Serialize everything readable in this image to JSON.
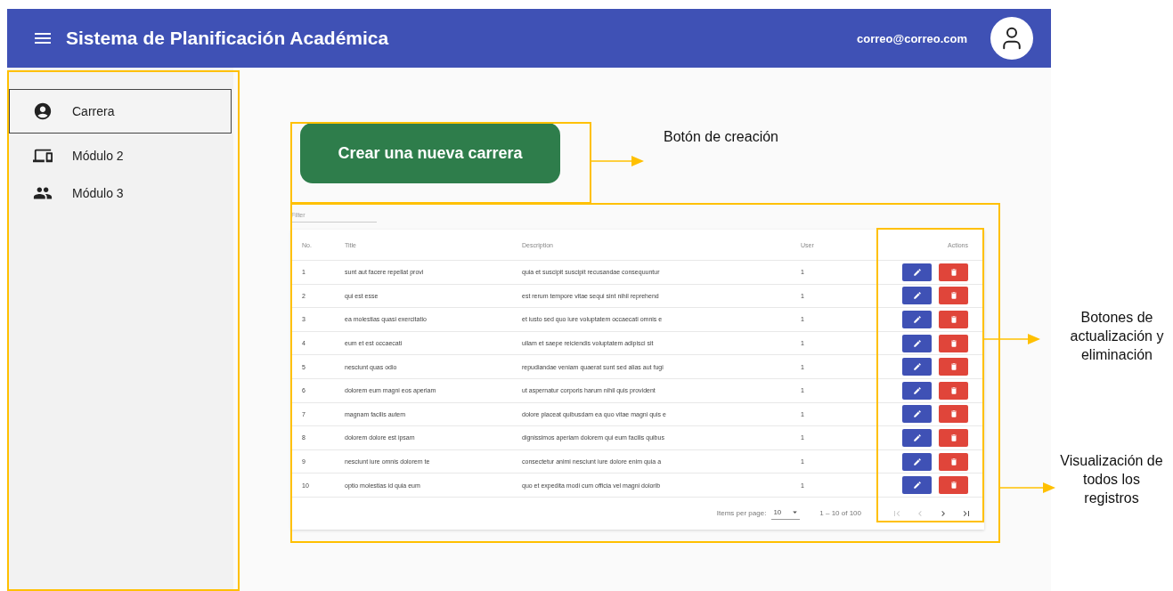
{
  "app_bar": {
    "title": "Sistema de Planificación Académica",
    "email": "correo@correo.com"
  },
  "sidebar": {
    "items": [
      {
        "kind": "account",
        "label": "Carrera",
        "selected": true
      },
      {
        "kind": "devices",
        "label": "Módulo 2",
        "selected": false
      },
      {
        "kind": "people",
        "label": "Módulo 3",
        "selected": false
      }
    ]
  },
  "create_button": {
    "label": "Crear una nueva carrera"
  },
  "table": {
    "filter": {
      "placeholder": "Filter"
    },
    "columns": [
      "No.",
      "Title",
      "Description",
      "User",
      "Actions"
    ],
    "rows": [
      {
        "no": "1",
        "title": "sunt aut facere repellat provi",
        "description": "quia et suscipit suscipit recusandae consequuntur",
        "user": "1"
      },
      {
        "no": "2",
        "title": "qui est esse",
        "description": "est rerum tempore vitae sequi sint nihil reprehend",
        "user": "1"
      },
      {
        "no": "3",
        "title": "ea molestias quasi exercitatio",
        "description": "et iusto sed quo iure voluptatem occaecati omnis e",
        "user": "1"
      },
      {
        "no": "4",
        "title": "eum et est occaecati",
        "description": "ullam et saepe reiciendis voluptatem adipisci sit",
        "user": "1"
      },
      {
        "no": "5",
        "title": "nesciunt quas odio",
        "description": "repudiandae veniam quaerat sunt sed alias aut fugi",
        "user": "1"
      },
      {
        "no": "6",
        "title": "dolorem eum magni eos aperiam",
        "description": "ut aspernatur corporis harum nihil quis provident",
        "user": "1"
      },
      {
        "no": "7",
        "title": "magnam facilis autem",
        "description": "dolore placeat quibusdam ea quo vitae magni quis e",
        "user": "1"
      },
      {
        "no": "8",
        "title": "dolorem dolore est ipsam",
        "description": "dignissimos aperiam dolorem qui eum facilis quibus",
        "user": "1"
      },
      {
        "no": "9",
        "title": "nesciunt iure omnis dolorem te",
        "description": "consectetur animi nesciunt iure dolore enim quia a",
        "user": "1"
      },
      {
        "no": "10",
        "title": "optio molestias id quia eum",
        "description": "quo et expedita modi cum officia vel magni dolorib",
        "user": "1"
      }
    ],
    "paginator": {
      "items_per_page_label": "Items per page:",
      "page_size": "10",
      "range": "1 – 10 of 100",
      "nav": [
        {
          "kind": "first",
          "disabled": true
        },
        {
          "kind": "prev",
          "disabled": true
        },
        {
          "kind": "next",
          "disabled": false
        },
        {
          "kind": "last",
          "disabled": false
        }
      ]
    }
  },
  "annotations": [
    {
      "kind": "creation",
      "text": "Botón de creación"
    },
    {
      "kind": "actions",
      "text": "Botones de actualización y eliminación"
    },
    {
      "kind": "records",
      "text": "Visualización de todos los registros"
    }
  ]
}
